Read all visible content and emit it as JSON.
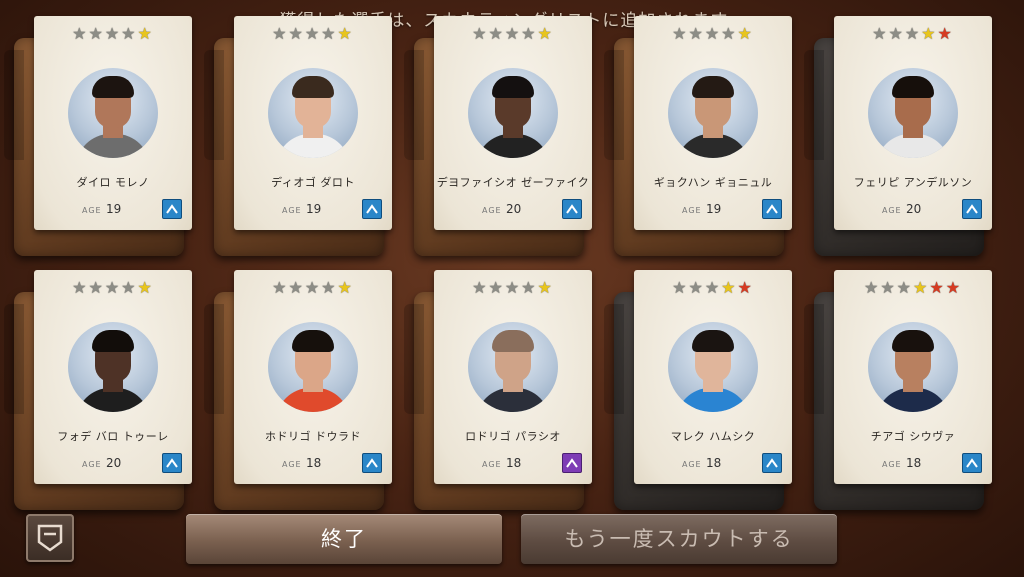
{
  "header": {
    "message": "獲得した選手は、スカウティングリストに追加されます。"
  },
  "age_label": "AGE",
  "cards": [
    {
      "name": "ダイロ モレノ",
      "age": "19",
      "stars": [
        0,
        0,
        0,
        0,
        1
      ],
      "badge": "blue",
      "folder": "brown",
      "skin": "#b0775a",
      "hair": "#1c1410",
      "shirt": "#6d6d6d"
    },
    {
      "name": "ディオゴ ダロト",
      "age": "19",
      "stars": [
        0,
        0,
        0,
        0,
        1
      ],
      "badge": "blue",
      "folder": "brown",
      "skin": "#e2b397",
      "hair": "#3a2a1e",
      "shirt": "#f0f0f0"
    },
    {
      "name": "デヨファイシオ ゼーファイク",
      "age": "20",
      "stars": [
        0,
        0,
        0,
        0,
        1
      ],
      "badge": "blue",
      "folder": "brown",
      "skin": "#5a3a2a",
      "hair": "#141010",
      "shirt": "#222222"
    },
    {
      "name": "ギョクハン ギョニュル",
      "age": "19",
      "stars": [
        0,
        0,
        0,
        0,
        1
      ],
      "badge": "blue",
      "folder": "brown",
      "skin": "#c99777",
      "hair": "#241a14",
      "shirt": "#2a2a2a"
    },
    {
      "name": "フェリピ アンデルソン",
      "age": "20",
      "stars": [
        0,
        0,
        0,
        1,
        2
      ],
      "badge": "blue",
      "folder": "dark",
      "skin": "#a86c4c",
      "hair": "#160f0b",
      "shirt": "#e8e8e8"
    },
    {
      "name": "フォデ バロ トゥーレ",
      "age": "20",
      "stars": [
        0,
        0,
        0,
        0,
        1
      ],
      "badge": "blue",
      "folder": "brown",
      "skin": "#4e3226",
      "hair": "#120d0a",
      "shirt": "#1e1e1e"
    },
    {
      "name": "ホドリゴ ドウラド",
      "age": "18",
      "stars": [
        0,
        0,
        0,
        0,
        1
      ],
      "badge": "blue",
      "folder": "brown",
      "skin": "#dba688",
      "hair": "#16100c",
      "shirt": "#e04a2c"
    },
    {
      "name": "ロドリゴ パラシオ",
      "age": "18",
      "stars": [
        0,
        0,
        0,
        0,
        1
      ],
      "badge": "purple",
      "folder": "brown",
      "skin": "#cfa388",
      "hair": "#8a6e5c",
      "shirt": "#2b2f3a"
    },
    {
      "name": "マレク ハムシク",
      "age": "18",
      "stars": [
        0,
        0,
        0,
        1,
        2
      ],
      "badge": "blue",
      "folder": "dark",
      "skin": "#e0b59b",
      "hair": "#1a1411",
      "shirt": "#2a84d2"
    },
    {
      "name": "チアゴ シウヴァ",
      "age": "18",
      "stars": [
        0,
        0,
        0,
        1,
        2,
        2
      ],
      "badge": "blue",
      "folder": "dark",
      "skin": "#b88060",
      "hair": "#18110d",
      "shirt": "#1d2b4a"
    }
  ],
  "buttons": {
    "finish_label": "終了",
    "scout_again_label": "もう一度スカウトする"
  },
  "icons": {
    "menu": "menu-icon",
    "position_badge": "position-chevron-icon"
  },
  "colors": {
    "badge_blue": "#2a86c8",
    "badge_purple": "#7e3cb5",
    "star_gray": "#8d8d86",
    "star_gold": "#e8c51d",
    "star_red": "#d63b22"
  }
}
